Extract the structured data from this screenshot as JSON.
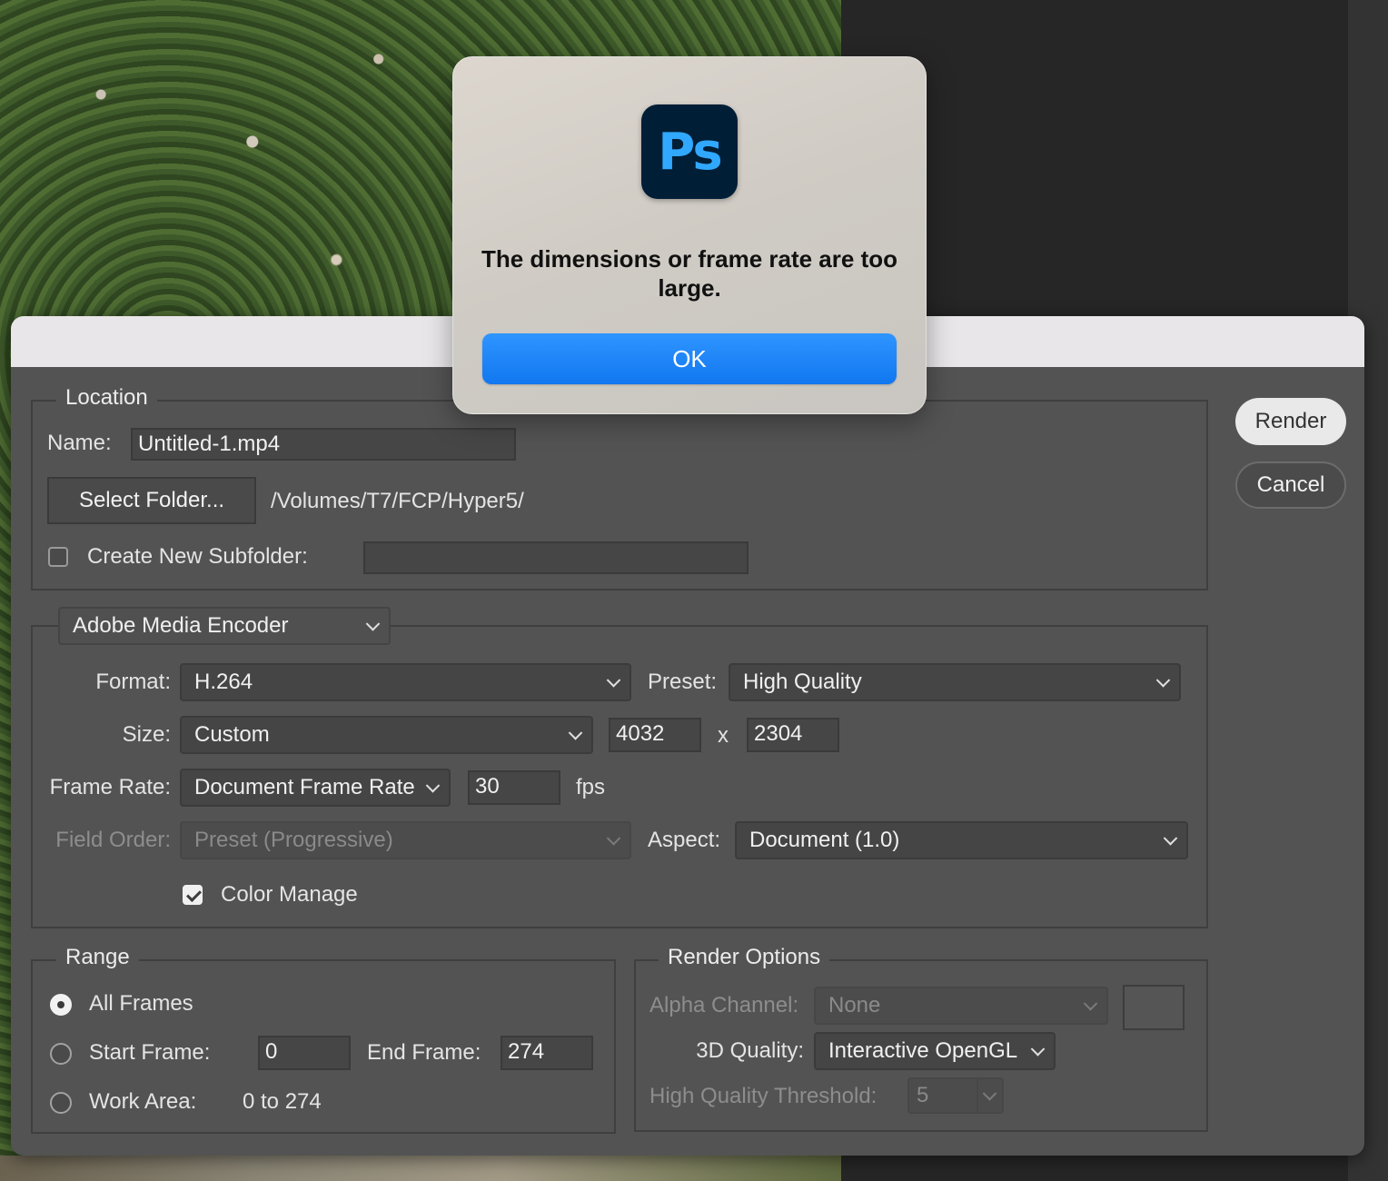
{
  "alert": {
    "app_icon_text": "Ps",
    "message": "The dimensions or frame rate are too large.",
    "ok_label": "OK"
  },
  "buttons": {
    "render": "Render",
    "cancel": "Cancel"
  },
  "location": {
    "legend": "Location",
    "name_label": "Name:",
    "name_value": "Untitled-1.mp4",
    "select_folder_label": "Select Folder...",
    "folder_path": "/Volumes/T7/FCP/Hyper5/",
    "subfolder_label": "Create New Subfolder:",
    "subfolder_checked": false,
    "subfolder_value": ""
  },
  "encoder": {
    "selected": "Adobe Media Encoder",
    "format_label": "Format:",
    "format_value": "H.264",
    "preset_label": "Preset:",
    "preset_value": "High Quality",
    "size_label": "Size:",
    "size_value": "Custom",
    "width": "4032",
    "x_label": "x",
    "height": "2304",
    "frame_rate_label": "Frame Rate:",
    "frame_rate_value": "Document Frame Rate",
    "fps_value": "30",
    "fps_label": "fps",
    "field_order_label": "Field Order:",
    "field_order_value": "Preset (Progressive)",
    "aspect_label": "Aspect:",
    "aspect_value": "Document (1.0)",
    "color_manage_label": "Color Manage",
    "color_manage_checked": true
  },
  "range": {
    "legend": "Range",
    "all_frames_label": "All Frames",
    "start_frame_label": "Start Frame:",
    "start_frame_value": "0",
    "end_frame_label": "End Frame:",
    "end_frame_value": "274",
    "work_area_label": "Work Area:",
    "work_area_value": "0 to 274",
    "selected": "All Frames"
  },
  "render_options": {
    "legend": "Render Options",
    "alpha_label": "Alpha Channel:",
    "alpha_value": "None",
    "quality_label": "3D Quality:",
    "quality_value": "Interactive OpenGL",
    "threshold_label": "High Quality Threshold:",
    "threshold_value": "5"
  },
  "colors": {
    "dialog_bg": "#535353",
    "ok_button": "#1a7ff5",
    "ps_icon_bg": "#001e36",
    "ps_icon_text": "#31a8ff"
  }
}
